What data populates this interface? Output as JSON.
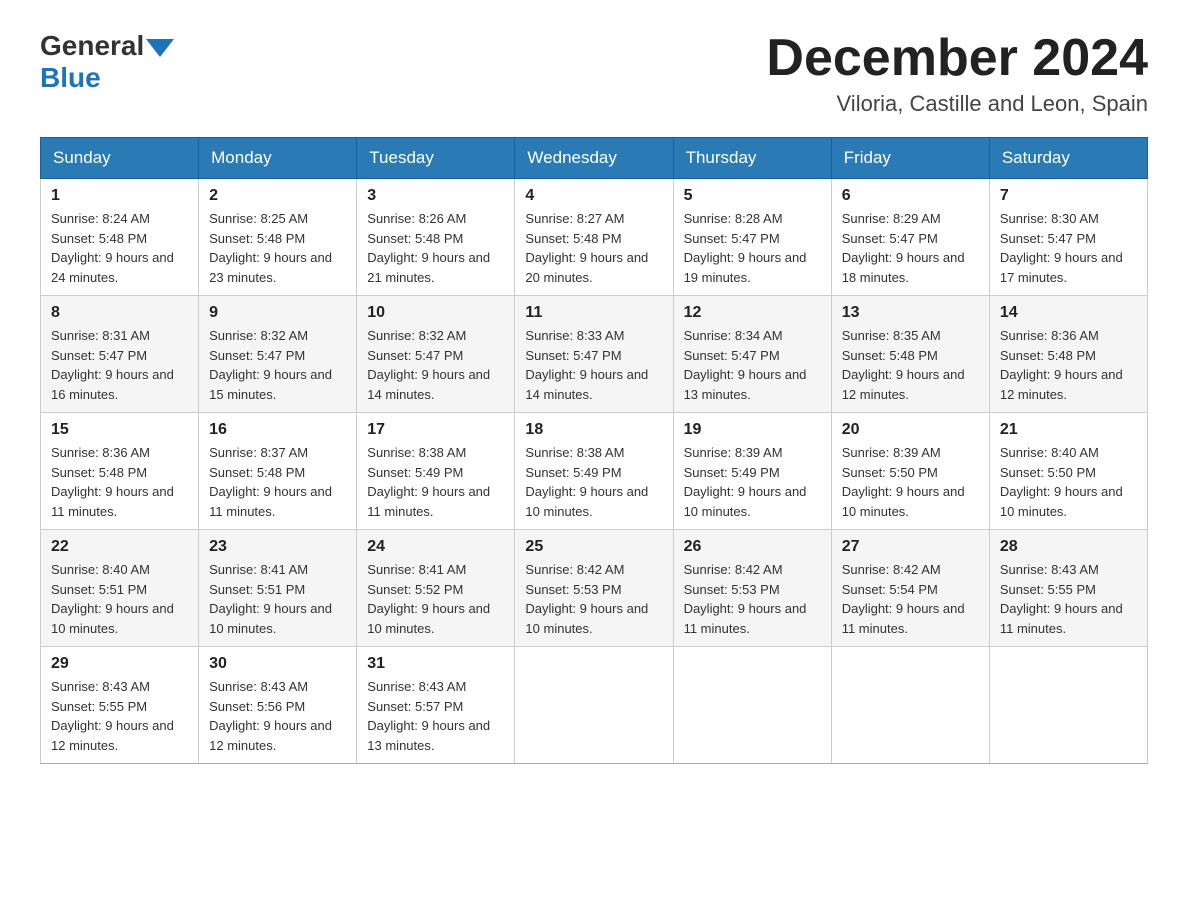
{
  "logo": {
    "general": "General",
    "blue": "Blue"
  },
  "title": {
    "month": "December 2024",
    "location": "Viloria, Castille and Leon, Spain"
  },
  "weekdays": [
    "Sunday",
    "Monday",
    "Tuesday",
    "Wednesday",
    "Thursday",
    "Friday",
    "Saturday"
  ],
  "weeks": [
    [
      {
        "day": "1",
        "sunrise": "Sunrise: 8:24 AM",
        "sunset": "Sunset: 5:48 PM",
        "daylight": "Daylight: 9 hours and 24 minutes."
      },
      {
        "day": "2",
        "sunrise": "Sunrise: 8:25 AM",
        "sunset": "Sunset: 5:48 PM",
        "daylight": "Daylight: 9 hours and 23 minutes."
      },
      {
        "day": "3",
        "sunrise": "Sunrise: 8:26 AM",
        "sunset": "Sunset: 5:48 PM",
        "daylight": "Daylight: 9 hours and 21 minutes."
      },
      {
        "day": "4",
        "sunrise": "Sunrise: 8:27 AM",
        "sunset": "Sunset: 5:48 PM",
        "daylight": "Daylight: 9 hours and 20 minutes."
      },
      {
        "day": "5",
        "sunrise": "Sunrise: 8:28 AM",
        "sunset": "Sunset: 5:47 PM",
        "daylight": "Daylight: 9 hours and 19 minutes."
      },
      {
        "day": "6",
        "sunrise": "Sunrise: 8:29 AM",
        "sunset": "Sunset: 5:47 PM",
        "daylight": "Daylight: 9 hours and 18 minutes."
      },
      {
        "day": "7",
        "sunrise": "Sunrise: 8:30 AM",
        "sunset": "Sunset: 5:47 PM",
        "daylight": "Daylight: 9 hours and 17 minutes."
      }
    ],
    [
      {
        "day": "8",
        "sunrise": "Sunrise: 8:31 AM",
        "sunset": "Sunset: 5:47 PM",
        "daylight": "Daylight: 9 hours and 16 minutes."
      },
      {
        "day": "9",
        "sunrise": "Sunrise: 8:32 AM",
        "sunset": "Sunset: 5:47 PM",
        "daylight": "Daylight: 9 hours and 15 minutes."
      },
      {
        "day": "10",
        "sunrise": "Sunrise: 8:32 AM",
        "sunset": "Sunset: 5:47 PM",
        "daylight": "Daylight: 9 hours and 14 minutes."
      },
      {
        "day": "11",
        "sunrise": "Sunrise: 8:33 AM",
        "sunset": "Sunset: 5:47 PM",
        "daylight": "Daylight: 9 hours and 14 minutes."
      },
      {
        "day": "12",
        "sunrise": "Sunrise: 8:34 AM",
        "sunset": "Sunset: 5:47 PM",
        "daylight": "Daylight: 9 hours and 13 minutes."
      },
      {
        "day": "13",
        "sunrise": "Sunrise: 8:35 AM",
        "sunset": "Sunset: 5:48 PM",
        "daylight": "Daylight: 9 hours and 12 minutes."
      },
      {
        "day": "14",
        "sunrise": "Sunrise: 8:36 AM",
        "sunset": "Sunset: 5:48 PM",
        "daylight": "Daylight: 9 hours and 12 minutes."
      }
    ],
    [
      {
        "day": "15",
        "sunrise": "Sunrise: 8:36 AM",
        "sunset": "Sunset: 5:48 PM",
        "daylight": "Daylight: 9 hours and 11 minutes."
      },
      {
        "day": "16",
        "sunrise": "Sunrise: 8:37 AM",
        "sunset": "Sunset: 5:48 PM",
        "daylight": "Daylight: 9 hours and 11 minutes."
      },
      {
        "day": "17",
        "sunrise": "Sunrise: 8:38 AM",
        "sunset": "Sunset: 5:49 PM",
        "daylight": "Daylight: 9 hours and 11 minutes."
      },
      {
        "day": "18",
        "sunrise": "Sunrise: 8:38 AM",
        "sunset": "Sunset: 5:49 PM",
        "daylight": "Daylight: 9 hours and 10 minutes."
      },
      {
        "day": "19",
        "sunrise": "Sunrise: 8:39 AM",
        "sunset": "Sunset: 5:49 PM",
        "daylight": "Daylight: 9 hours and 10 minutes."
      },
      {
        "day": "20",
        "sunrise": "Sunrise: 8:39 AM",
        "sunset": "Sunset: 5:50 PM",
        "daylight": "Daylight: 9 hours and 10 minutes."
      },
      {
        "day": "21",
        "sunrise": "Sunrise: 8:40 AM",
        "sunset": "Sunset: 5:50 PM",
        "daylight": "Daylight: 9 hours and 10 minutes."
      }
    ],
    [
      {
        "day": "22",
        "sunrise": "Sunrise: 8:40 AM",
        "sunset": "Sunset: 5:51 PM",
        "daylight": "Daylight: 9 hours and 10 minutes."
      },
      {
        "day": "23",
        "sunrise": "Sunrise: 8:41 AM",
        "sunset": "Sunset: 5:51 PM",
        "daylight": "Daylight: 9 hours and 10 minutes."
      },
      {
        "day": "24",
        "sunrise": "Sunrise: 8:41 AM",
        "sunset": "Sunset: 5:52 PM",
        "daylight": "Daylight: 9 hours and 10 minutes."
      },
      {
        "day": "25",
        "sunrise": "Sunrise: 8:42 AM",
        "sunset": "Sunset: 5:53 PM",
        "daylight": "Daylight: 9 hours and 10 minutes."
      },
      {
        "day": "26",
        "sunrise": "Sunrise: 8:42 AM",
        "sunset": "Sunset: 5:53 PM",
        "daylight": "Daylight: 9 hours and 11 minutes."
      },
      {
        "day": "27",
        "sunrise": "Sunrise: 8:42 AM",
        "sunset": "Sunset: 5:54 PM",
        "daylight": "Daylight: 9 hours and 11 minutes."
      },
      {
        "day": "28",
        "sunrise": "Sunrise: 8:43 AM",
        "sunset": "Sunset: 5:55 PM",
        "daylight": "Daylight: 9 hours and 11 minutes."
      }
    ],
    [
      {
        "day": "29",
        "sunrise": "Sunrise: 8:43 AM",
        "sunset": "Sunset: 5:55 PM",
        "daylight": "Daylight: 9 hours and 12 minutes."
      },
      {
        "day": "30",
        "sunrise": "Sunrise: 8:43 AM",
        "sunset": "Sunset: 5:56 PM",
        "daylight": "Daylight: 9 hours and 12 minutes."
      },
      {
        "day": "31",
        "sunrise": "Sunrise: 8:43 AM",
        "sunset": "Sunset: 5:57 PM",
        "daylight": "Daylight: 9 hours and 13 minutes."
      },
      null,
      null,
      null,
      null
    ]
  ]
}
